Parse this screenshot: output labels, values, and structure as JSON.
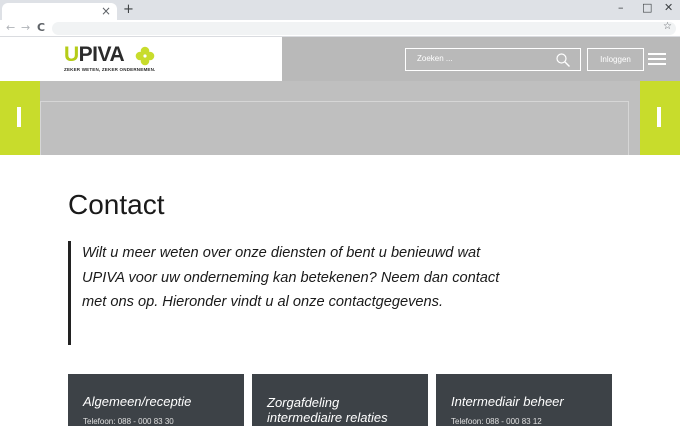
{
  "browser": {
    "tab_close": "×",
    "new_tab": "+",
    "window_controls": {
      "minimize": "–",
      "maximize": "□",
      "close": "✕"
    },
    "nav": {
      "back": "←",
      "forward": "→",
      "reload": "C"
    },
    "bookmark_icon": "☆"
  },
  "header": {
    "logo": {
      "u": "U",
      "rest": "PIVA",
      "tagline": "ZEKER WETEN, ZEKER ONDERNEMEN."
    },
    "search_placeholder": "Zoeken ...",
    "login_label": "Inloggen"
  },
  "colors": {
    "accent": "#c8dc2c",
    "header_bg": "#b9b9b9",
    "card_bg": "#3d4247"
  },
  "main": {
    "title": "Contact",
    "intro": "Wilt u meer weten over onze diensten of bent u benieuwd wat UPIVA voor uw onderneming kan betekenen? Neem dan contact met ons op. Hieronder vindt u al onze contactgegevens."
  },
  "cards": [
    {
      "title": "Algemeen/receptie",
      "phone": "Telefoon: 088 - 000 83 30"
    },
    {
      "title": "Zorgafdeling intermediaire relaties",
      "phone": ""
    },
    {
      "title": "Intermediair beheer",
      "phone": "Telefoon: 088 - 000 83 12"
    }
  ]
}
